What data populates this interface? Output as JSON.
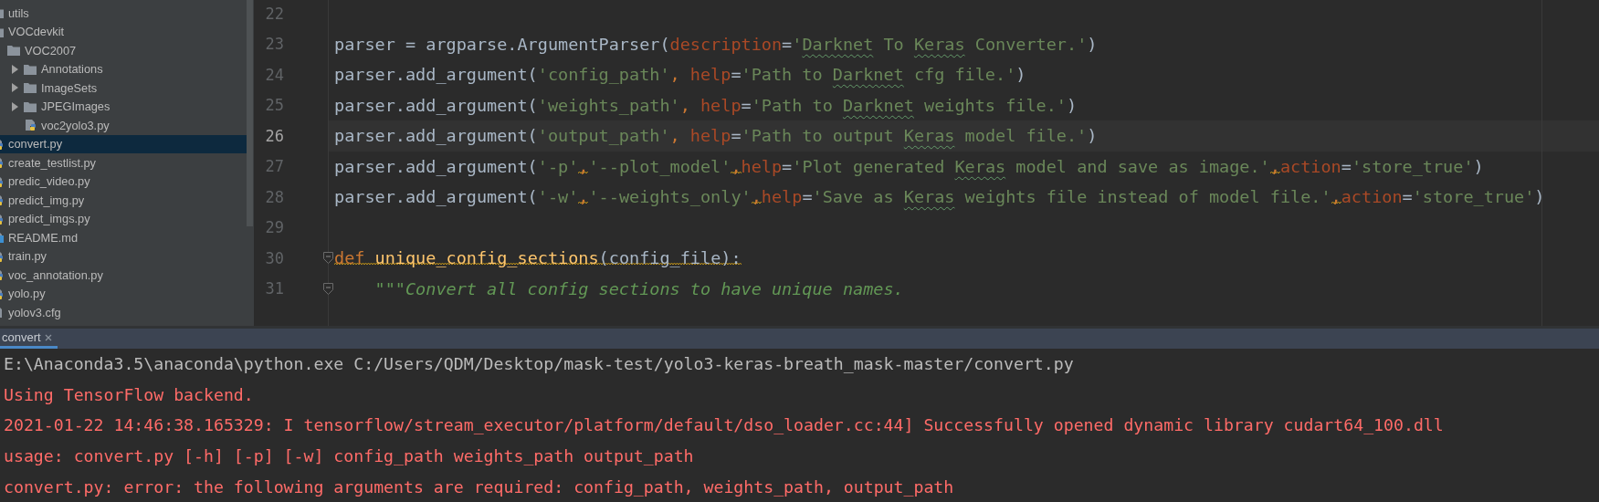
{
  "project_tree": {
    "items": [
      {
        "label": "utils",
        "kind": "folder",
        "selected": false
      },
      {
        "label": "VOCdevkit",
        "kind": "folder",
        "selected": false,
        "children": [
          {
            "label": "VOC2007",
            "kind": "folder",
            "selected": false,
            "children": [
              {
                "label": "Annotations",
                "kind": "folder",
                "expanded": false,
                "selected": false
              },
              {
                "label": "ImageSets",
                "kind": "folder",
                "expanded": false,
                "selected": false
              },
              {
                "label": "JPEGImages",
                "kind": "folder",
                "expanded": false,
                "selected": false
              },
              {
                "label": "voc2yolo3.py",
                "kind": "python",
                "selected": false
              }
            ]
          }
        ]
      },
      {
        "label": "convert.py",
        "kind": "python",
        "selected": true
      },
      {
        "label": "create_testlist.py",
        "kind": "python",
        "selected": false
      },
      {
        "label": "predic_video.py",
        "kind": "python",
        "selected": false
      },
      {
        "label": "predict_img.py",
        "kind": "python",
        "selected": false
      },
      {
        "label": "predict_imgs.py",
        "kind": "python",
        "selected": false
      },
      {
        "label": "README.md",
        "kind": "markdown",
        "selected": false
      },
      {
        "label": "train.py",
        "kind": "python",
        "selected": false
      },
      {
        "label": "voc_annotation.py",
        "kind": "python",
        "selected": false
      },
      {
        "label": "yolo.py",
        "kind": "python",
        "selected": false
      },
      {
        "label": "yolov3.cfg",
        "kind": "config",
        "selected": false
      }
    ]
  },
  "editor": {
    "lines": [
      {
        "number": "22",
        "current": false,
        "fold": false
      },
      {
        "number": "23",
        "current": false,
        "fold": false,
        "tokens": [
          {
            "text": "parser = argparse.ArgumentParser(",
            "kind": "plain"
          },
          {
            "text": "description",
            "kind": "param"
          },
          {
            "text": "=",
            "kind": "plain"
          },
          {
            "text": "'",
            "kind": "string"
          },
          {
            "text": "Darknet",
            "kind": "string",
            "typo": true
          },
          {
            "text": " To ",
            "kind": "string"
          },
          {
            "text": "Keras",
            "kind": "string",
            "typo": true
          },
          {
            "text": " Converter.'",
            "kind": "string"
          },
          {
            "text": ")",
            "kind": "plain"
          }
        ]
      },
      {
        "number": "24",
        "current": false,
        "fold": false,
        "tokens": [
          {
            "text": "parser.add_argument(",
            "kind": "plain"
          },
          {
            "text": "'config_path'",
            "kind": "string"
          },
          {
            "text": ", ",
            "kind": "keyword"
          },
          {
            "text": "help",
            "kind": "param"
          },
          {
            "text": "=",
            "kind": "plain"
          },
          {
            "text": "'Path to ",
            "kind": "string"
          },
          {
            "text": "Darknet",
            "kind": "string",
            "typo": true
          },
          {
            "text": " cfg file.'",
            "kind": "string"
          },
          {
            "text": ")",
            "kind": "plain"
          }
        ]
      },
      {
        "number": "25",
        "current": false,
        "fold": false,
        "tokens": [
          {
            "text": "parser.add_argument(",
            "kind": "plain"
          },
          {
            "text": "'weights_path'",
            "kind": "string"
          },
          {
            "text": ", ",
            "kind": "keyword"
          },
          {
            "text": "help",
            "kind": "param"
          },
          {
            "text": "=",
            "kind": "plain"
          },
          {
            "text": "'Path to ",
            "kind": "string"
          },
          {
            "text": "Darknet",
            "kind": "string",
            "typo": true
          },
          {
            "text": " weights file.'",
            "kind": "string"
          },
          {
            "text": ")",
            "kind": "plain"
          }
        ]
      },
      {
        "number": "26",
        "current": true,
        "fold": false,
        "tokens": [
          {
            "text": "parser.add_argument(",
            "kind": "plain"
          },
          {
            "text": "'output_path'",
            "kind": "string"
          },
          {
            "text": ", ",
            "kind": "keyword"
          },
          {
            "text": "help",
            "kind": "param"
          },
          {
            "text": "=",
            "kind": "plain"
          },
          {
            "text": "'Path to output ",
            "kind": "string"
          },
          {
            "text": "Keras",
            "kind": "string",
            "typo": true
          },
          {
            "text": " model file.'",
            "kind": "string"
          },
          {
            "text": ")",
            "kind": "plain"
          }
        ]
      },
      {
        "number": "27",
        "current": false,
        "fold": false,
        "tokens": [
          {
            "text": "parser.add_argument(",
            "kind": "plain"
          },
          {
            "text": "'-p'",
            "kind": "string"
          },
          {
            "text": ",",
            "kind": "keyword",
            "warning": true
          },
          {
            "text": "'--plot_model'",
            "kind": "string"
          },
          {
            "text": ",",
            "kind": "keyword",
            "warning": true
          },
          {
            "text": "help",
            "kind": "param"
          },
          {
            "text": "=",
            "kind": "plain"
          },
          {
            "text": "'Plot generated ",
            "kind": "string"
          },
          {
            "text": "Keras",
            "kind": "string",
            "typo": true
          },
          {
            "text": " model and save as image.'",
            "kind": "string"
          },
          {
            "text": ",",
            "kind": "keyword",
            "warning": true
          },
          {
            "text": "action",
            "kind": "param"
          },
          {
            "text": "=",
            "kind": "plain"
          },
          {
            "text": "'store_true'",
            "kind": "string"
          },
          {
            "text": ")",
            "kind": "plain"
          }
        ]
      },
      {
        "number": "28",
        "current": false,
        "fold": false,
        "tokens": [
          {
            "text": "parser.add_argument(",
            "kind": "plain"
          },
          {
            "text": "'-w'",
            "kind": "string"
          },
          {
            "text": ",",
            "kind": "keyword",
            "warning": true
          },
          {
            "text": "'--weights_only'",
            "kind": "string"
          },
          {
            "text": ",",
            "kind": "keyword",
            "warning": true
          },
          {
            "text": "help",
            "kind": "param"
          },
          {
            "text": "=",
            "kind": "plain"
          },
          {
            "text": "'Save as ",
            "kind": "string"
          },
          {
            "text": "Keras",
            "kind": "string",
            "typo": true
          },
          {
            "text": " weights file instead of model file.'",
            "kind": "string"
          },
          {
            "text": ",",
            "kind": "keyword",
            "warning": true
          },
          {
            "text": "action",
            "kind": "param"
          },
          {
            "text": "=",
            "kind": "plain"
          },
          {
            "text": "'store_true'",
            "kind": "string"
          },
          {
            "text": ")",
            "kind": "plain"
          }
        ]
      },
      {
        "number": "29",
        "current": false,
        "fold": false
      },
      {
        "number": "30",
        "current": false,
        "fold": true,
        "tokens": [
          {
            "text": "def ",
            "kind": "keyword",
            "warning": true
          },
          {
            "text": "unique_config_sections",
            "kind": "function",
            "warning": true
          },
          {
            "text": "(config_file):",
            "kind": "plain",
            "warning": true
          }
        ]
      },
      {
        "number": "31",
        "current": false,
        "fold": true,
        "tokens": [
          {
            "text": "    \"\"\"Convert all config sections to have unique names.",
            "kind": "docstring"
          }
        ]
      }
    ]
  },
  "run_panel": {
    "tabs": [
      {
        "label": "convert",
        "selected": true
      }
    ],
    "output": [
      {
        "text": "E:\\Anaconda3.5\\anaconda\\python.exe C:/Users/QDM/Desktop/mask-test/yolo3-keras-breath_mask-master/convert.py",
        "kind": "command"
      },
      {
        "text": "Using TensorFlow backend.",
        "kind": "error"
      },
      {
        "text": "2021-01-22 14:46:38.165329: I tensorflow/stream_executor/platform/default/dso_loader.cc:44] Successfully opened dynamic library cudart64_100.dll",
        "kind": "error"
      },
      {
        "text": "usage: convert.py [-h] [-p] [-w] config_path weights_path output_path",
        "kind": "error"
      },
      {
        "text": "convert.py: error: the following arguments are required: config_path, weights_path, output_path",
        "kind": "error"
      }
    ]
  }
}
